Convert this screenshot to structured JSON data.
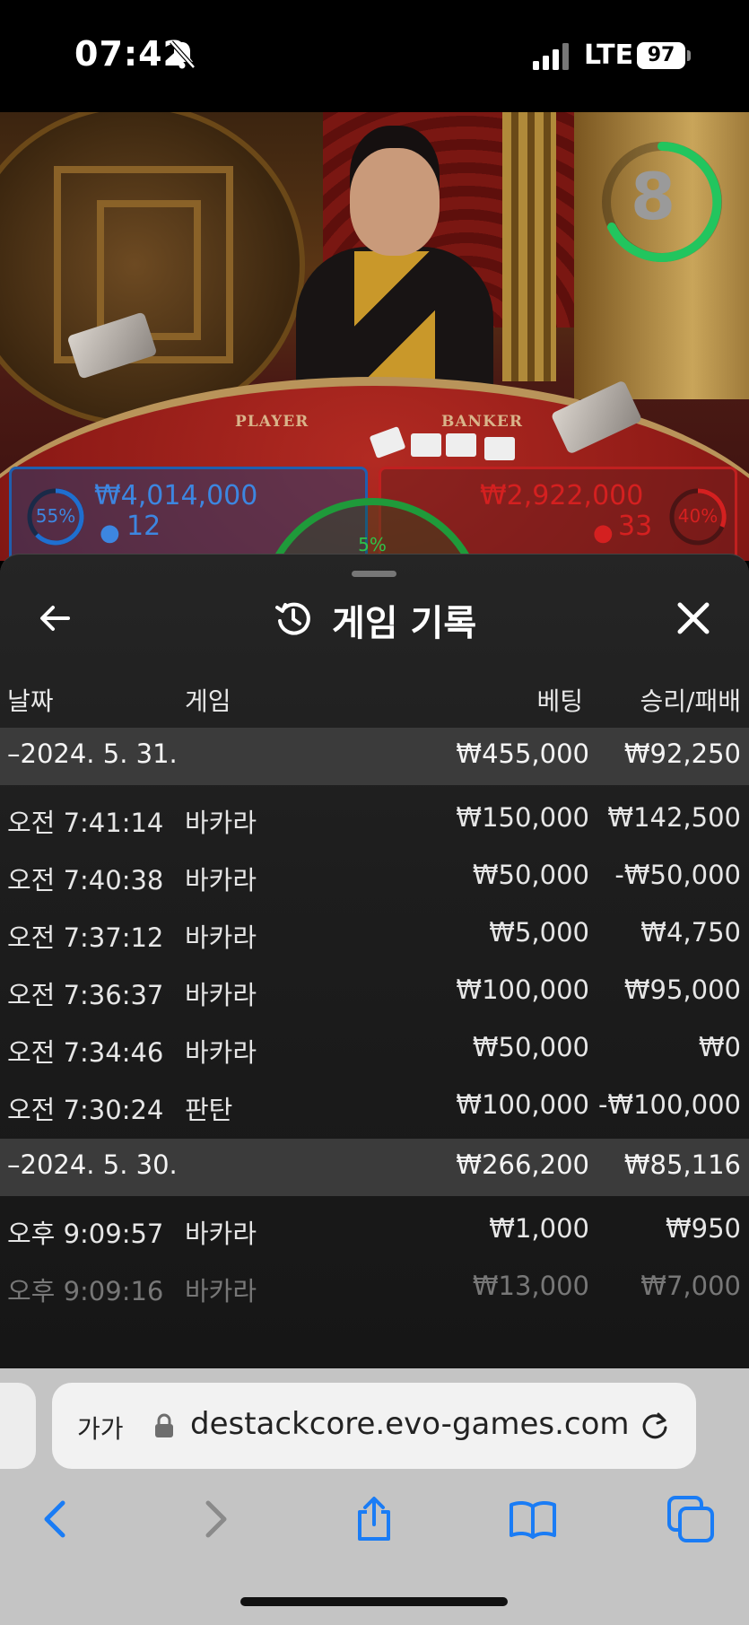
{
  "status": {
    "time": "07:42",
    "network": "LTE",
    "battery": "97"
  },
  "video": {
    "timer": "8",
    "table_player_text": "PLAYER",
    "table_banker_text": "BANKER",
    "player": {
      "percent": "55%",
      "amount": "₩4,014,000",
      "count": "12"
    },
    "banker": {
      "percent": "40%",
      "amount": "₩2,922,000",
      "count": "33"
    },
    "tie_percent": "5%"
  },
  "panel": {
    "title": "게임 기록",
    "columns": {
      "date": "날짜",
      "game": "게임",
      "bet": "베팅",
      "result": "승리/패배"
    },
    "groups": [
      {
        "date": "–2024. 5. 31.",
        "bet_total": "₩455,000",
        "result_total": "₩92,250",
        "rows": [
          {
            "time": "오전 7:41:14",
            "game": "바카라",
            "bet": "₩150,000",
            "result": "₩142,500"
          },
          {
            "time": "오전 7:40:38",
            "game": "바카라",
            "bet": "₩50,000",
            "result": "-₩50,000"
          },
          {
            "time": "오전 7:37:12",
            "game": "바카라",
            "bet": "₩5,000",
            "result": "₩4,750"
          },
          {
            "time": "오전 7:36:37",
            "game": "바카라",
            "bet": "₩100,000",
            "result": "₩95,000"
          },
          {
            "time": "오전 7:34:46",
            "game": "바카라",
            "bet": "₩50,000",
            "result": "₩0"
          },
          {
            "time": "오전 7:30:24",
            "game": "판탄",
            "bet": "₩100,000",
            "result": "-₩100,000"
          }
        ]
      },
      {
        "date": "–2024. 5. 30.",
        "bet_total": "₩266,200",
        "result_total": "₩85,116",
        "rows": [
          {
            "time": "오후 9:09:57",
            "game": "바카라",
            "bet": "₩1,000",
            "result": "₩950"
          },
          {
            "time": "오후 9:09:16",
            "game": "바카라",
            "bet": "₩13,000",
            "result": "₩7,000"
          }
        ]
      }
    ]
  },
  "browser": {
    "text_size_label": "가가",
    "url": "destackcore.evo-games.com",
    "icons": [
      "back-icon",
      "forward-icon",
      "share-icon",
      "bookmarks-icon",
      "tabs-icon"
    ]
  },
  "colors": {
    "accent": "#1a7cf5",
    "player_blue": "#1f5fb0",
    "banker_red": "#d42020",
    "timer_green": "#22c55e"
  }
}
